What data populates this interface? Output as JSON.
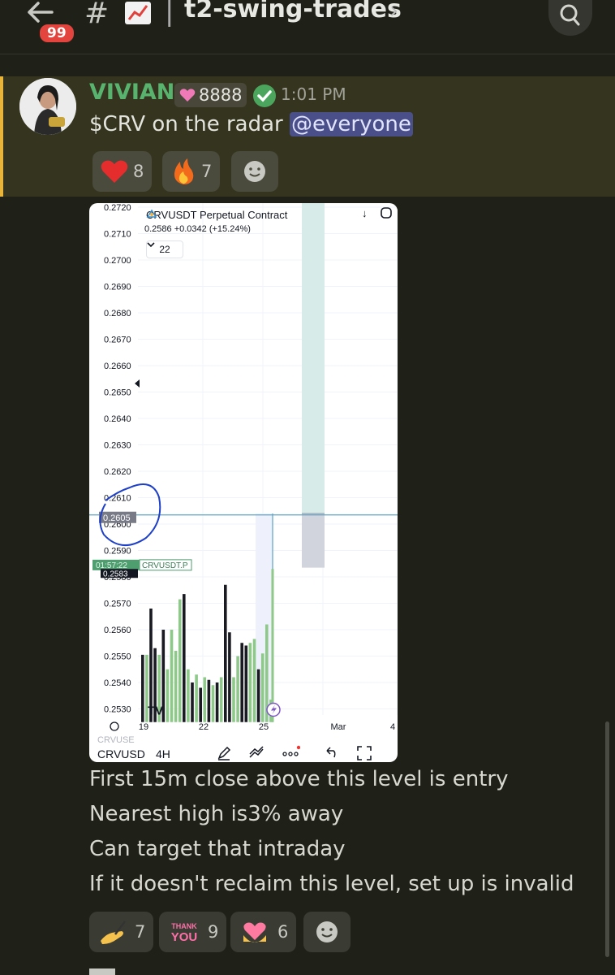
{
  "header": {
    "unread_count": "99",
    "hash": "#",
    "channel_emoji": "chart-increasing-emoji",
    "pipe": "|",
    "channel_name": "t2-swing-trades",
    "chevron": "›"
  },
  "message1": {
    "author": "VIVIAN",
    "tag_value": "8888",
    "time": "1:01 PM",
    "text": "$CRV on the radar ",
    "mention": "@everyone",
    "reactions": [
      {
        "emoji": "heart-emoji",
        "count": "8"
      },
      {
        "emoji": "fire-emoji",
        "count": "7"
      }
    ]
  },
  "chart": {
    "symbol_title": "CRVUSDT Perpetual Contract",
    "price_line": "0.2586  +0.0342 (+15.24%)",
    "interval_chip": "22",
    "y_ticks": [
      "0.2720",
      "0.2710",
      "0.2700",
      "0.2690",
      "0.2680",
      "0.2670",
      "0.2660",
      "0.2650",
      "0.2640",
      "0.2630",
      "0.2620",
      "0.2610",
      "0.2600",
      "0.2590",
      "0.2580",
      "0.2570",
      "0.2560",
      "0.2550",
      "0.2540",
      "0.2530"
    ],
    "x_ticks": [
      "19",
      "22",
      "25",
      "Mar",
      "4"
    ],
    "price_tag": "0.2605",
    "countdown_tag": "01:57:22",
    "symbol_tag": "CRVUSDT.P",
    "last_price_tag": "0.2583",
    "bottom_symbol": "CRVUSD",
    "bottom_symbol_ghost": "CRVUSE",
    "bottom_interval": "4H",
    "colors": {
      "up": "#8ec98a",
      "down": "#1a1a22",
      "line": "#5fa5c7",
      "tag_green": "#4e9e6f"
    }
  },
  "chart_data": {
    "type": "bar",
    "ylim": [
      0.2525,
      0.272
    ],
    "x_axis_ticks": [
      "19",
      "22",
      "25",
      "Mar",
      "4"
    ],
    "y_axis_ticks": [
      0.272,
      0.271,
      0.27,
      0.269,
      0.268,
      0.267,
      0.266,
      0.265,
      0.264,
      0.263,
      0.262,
      0.261,
      0.26,
      0.259,
      0.258,
      0.257,
      0.256,
      0.255,
      0.254,
      0.253
    ],
    "horizontal_level": 0.2605,
    "last_price": 0.2583,
    "bars": [
      {
        "v": 0.25505,
        "c": "down"
      },
      {
        "v": 0.25505,
        "c": "up"
      },
      {
        "v": 0.2568,
        "c": "down"
      },
      {
        "v": 0.2553,
        "c": "down"
      },
      {
        "v": 0.25505,
        "c": "up"
      },
      {
        "v": 0.256,
        "c": "down"
      },
      {
        "v": 0.2545,
        "c": "up"
      },
      {
        "v": 0.256,
        "c": "up"
      },
      {
        "v": 0.2552,
        "c": "up"
      },
      {
        "v": 0.25715,
        "c": "up"
      },
      {
        "v": 0.25735,
        "c": "down"
      },
      {
        "v": 0.2545,
        "c": "up"
      },
      {
        "v": 0.254,
        "c": "down"
      },
      {
        "v": 0.2543,
        "c": "up"
      },
      {
        "v": 0.2538,
        "c": "down"
      },
      {
        "v": 0.2542,
        "c": "up"
      },
      {
        "v": 0.2541,
        "c": "down"
      },
      {
        "v": 0.2539,
        "c": "up"
      },
      {
        "v": 0.254,
        "c": "down"
      },
      {
        "v": 0.2542,
        "c": "up"
      },
      {
        "v": 0.2577,
        "c": "down"
      },
      {
        "v": 0.2559,
        "c": "down"
      },
      {
        "v": 0.2542,
        "c": "up"
      },
      {
        "v": 0.255,
        "c": "up"
      },
      {
        "v": 0.2555,
        "c": "down"
      },
      {
        "v": 0.2554,
        "c": "down"
      },
      {
        "v": 0.2555,
        "c": "up"
      },
      {
        "v": 0.25565,
        "c": "up"
      },
      {
        "v": 0.2545,
        "c": "down"
      },
      {
        "v": 0.2551,
        "c": "up"
      },
      {
        "v": 0.2562,
        "c": "up"
      },
      {
        "v": 0.25335,
        "c": "up"
      }
    ]
  },
  "message2": {
    "lines": [
      "First 15m close above this level is entry",
      "Nearest high is3% away",
      "Can target that intraday",
      "If it doesn't reclaim this level, set up is invalid"
    ],
    "reactions": [
      {
        "emoji": "writing-hand-emoji",
        "count": "7"
      },
      {
        "emoji": "thank-you-emoji",
        "label": "THANK YOU",
        "count": "9"
      },
      {
        "emoji": "heart-hands-emoji",
        "count": "6"
      }
    ]
  }
}
